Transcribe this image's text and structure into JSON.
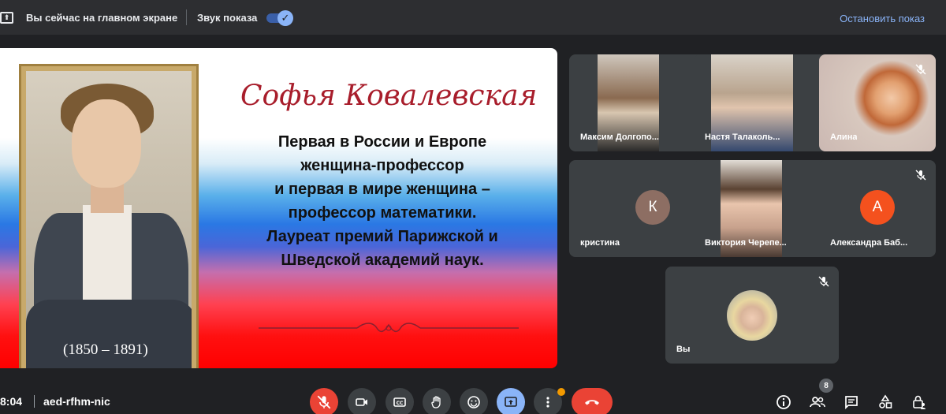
{
  "banner": {
    "title": "Вы сейчас на главном экране",
    "sound_label": "Звук показа",
    "sound_on": true,
    "stop_label": "Остановить показ"
  },
  "slide": {
    "title": "Софья Ковалевская",
    "lines": [
      "Первая в России и Европе",
      "женщина-профессор",
      "и первая в мире женщина –",
      "профессор математики.",
      "Лауреат премий Парижской и",
      "Шведской академий наук."
    ],
    "years": "(1850 – 1891)"
  },
  "participants": [
    {
      "name": "Максим Долгопо...",
      "mic_off": true,
      "video": true
    },
    {
      "name": "Настя Талаколь...",
      "mic_off": true,
      "video": true
    },
    {
      "name": "Алина",
      "mic_off": true,
      "video": true
    },
    {
      "name": "кристина",
      "mic_off": true,
      "avatar_letter": "К",
      "avatar_color": "#8d6e63"
    },
    {
      "name": "Виктория Черепе...",
      "mic_off": true,
      "video": true
    },
    {
      "name": "Александра Баб...",
      "mic_off": true,
      "avatar_letter": "А",
      "avatar_color": "#f4511e"
    },
    {
      "name": "Вы",
      "mic_off": true,
      "video": true
    }
  ],
  "bottombar": {
    "time": "8:04",
    "meeting_code": "aed-rfhm-nic",
    "people_count": "8",
    "colors": {
      "end_call": "#ea4335",
      "mic_muted": "#ea4335",
      "present_active": "#8ab4f8"
    }
  }
}
